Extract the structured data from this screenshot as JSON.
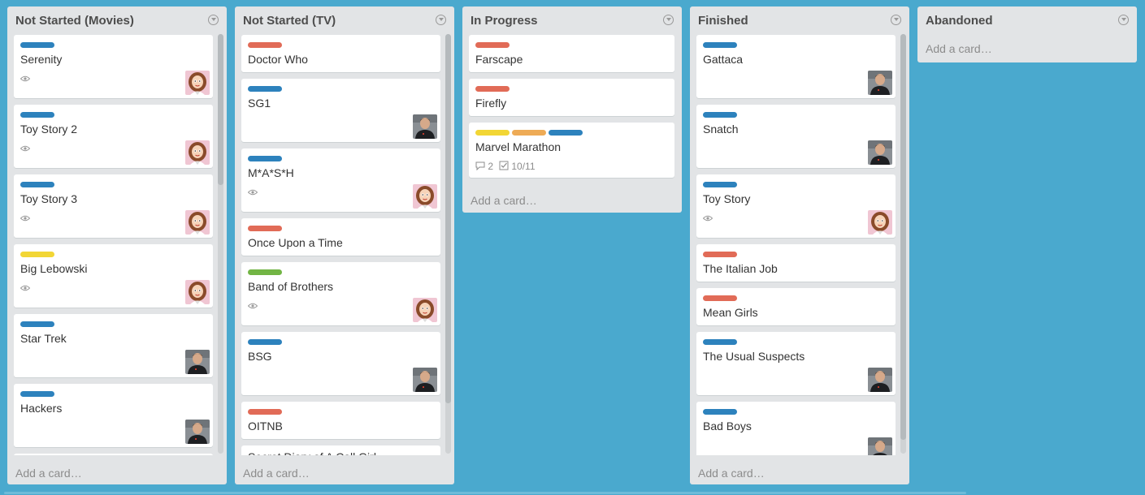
{
  "colors": {
    "background": "#4aa9ce",
    "blue": "#2d82bd",
    "red": "#e16b57",
    "yellow": "#f2d635",
    "orange": "#eeab56",
    "green": "#72b545"
  },
  "lists": [
    {
      "title": "Not Started (Movies)",
      "add_card": "Add a card…",
      "cards": [
        {
          "title": "Serenity",
          "labels": [
            "blue"
          ],
          "watching": true,
          "avatar": "woman"
        },
        {
          "title": "Toy Story 2",
          "labels": [
            "blue"
          ],
          "watching": true,
          "avatar": "woman"
        },
        {
          "title": "Toy Story 3",
          "labels": [
            "blue"
          ],
          "watching": true,
          "avatar": "woman"
        },
        {
          "title": "Big Lebowski",
          "labels": [
            "yellow"
          ],
          "watching": true,
          "avatar": "woman"
        },
        {
          "title": "Star Trek",
          "labels": [
            "blue"
          ],
          "watching": false,
          "avatar": "man"
        },
        {
          "title": "Hackers",
          "labels": [
            "blue"
          ],
          "watching": false,
          "avatar": "man"
        }
      ]
    },
    {
      "title": "Not Started (TV)",
      "add_card": "Add a card…",
      "cards": [
        {
          "title": "Doctor Who",
          "labels": [
            "red"
          ],
          "watching": false,
          "avatar": ""
        },
        {
          "title": "SG1",
          "labels": [
            "blue"
          ],
          "watching": false,
          "avatar": "man"
        },
        {
          "title": "M*A*S*H",
          "labels": [
            "blue"
          ],
          "watching": true,
          "avatar": "woman"
        },
        {
          "title": "Once Upon a Time",
          "labels": [
            "red"
          ],
          "watching": false,
          "avatar": ""
        },
        {
          "title": "Band of Brothers",
          "labels": [
            "green"
          ],
          "watching": true,
          "avatar": "woman"
        },
        {
          "title": "BSG",
          "labels": [
            "blue"
          ],
          "watching": false,
          "avatar": "man"
        },
        {
          "title": "OITNB",
          "labels": [
            "red"
          ],
          "watching": false,
          "avatar": ""
        },
        {
          "title": "Secret Diary of A Call Girl",
          "labels": [],
          "watching": false,
          "avatar": ""
        }
      ]
    },
    {
      "title": "In Progress",
      "add_card": "Add a card…",
      "cards": [
        {
          "title": "Farscape",
          "labels": [
            "red"
          ],
          "watching": false,
          "avatar": ""
        },
        {
          "title": "Firefly",
          "labels": [
            "red"
          ],
          "watching": false,
          "avatar": ""
        },
        {
          "title": "Marvel Marathon",
          "labels": [
            "yellow",
            "orange",
            "blue"
          ],
          "watching": false,
          "avatar": "",
          "comments": "2",
          "checklist": "10/11"
        }
      ]
    },
    {
      "title": "Finished",
      "add_card": "Add a card…",
      "cards": [
        {
          "title": "Gattaca",
          "labels": [
            "blue"
          ],
          "watching": false,
          "avatar": "man"
        },
        {
          "title": "Snatch",
          "labels": [
            "blue"
          ],
          "watching": false,
          "avatar": "man"
        },
        {
          "title": "Toy Story",
          "labels": [
            "blue"
          ],
          "watching": true,
          "avatar": "woman"
        },
        {
          "title": "The Italian Job",
          "labels": [
            "red"
          ],
          "watching": false,
          "avatar": ""
        },
        {
          "title": "Mean Girls",
          "labels": [
            "red"
          ],
          "watching": false,
          "avatar": ""
        },
        {
          "title": "The Usual Suspects",
          "labels": [
            "blue"
          ],
          "watching": false,
          "avatar": "man"
        },
        {
          "title": "Bad Boys",
          "labels": [
            "blue"
          ],
          "watching": false,
          "avatar": "man"
        }
      ]
    },
    {
      "title": "Abandoned",
      "add_card": "Add a card…",
      "cards": []
    }
  ]
}
